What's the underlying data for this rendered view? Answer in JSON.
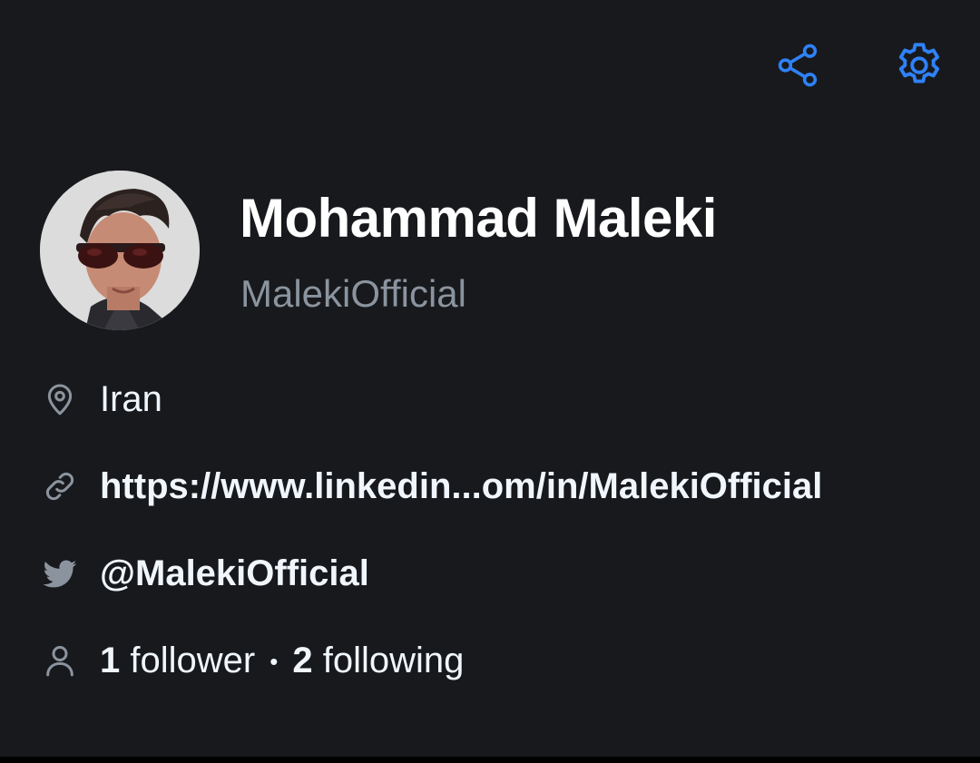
{
  "header": {
    "share_icon": "share-icon",
    "settings_icon": "gear-icon",
    "accent_color": "#2f81f7"
  },
  "profile": {
    "name": "Mohammad Maleki",
    "login": "MalekiOfficial",
    "avatar": "avatar"
  },
  "details": {
    "location": "Iran",
    "website": "https://www.linkedin...om/in/MalekiOfficial",
    "twitter": "@MalekiOfficial",
    "followers_count": "1",
    "followers_label": "follower",
    "separator": "•",
    "following_count": "2",
    "following_label": "following"
  }
}
